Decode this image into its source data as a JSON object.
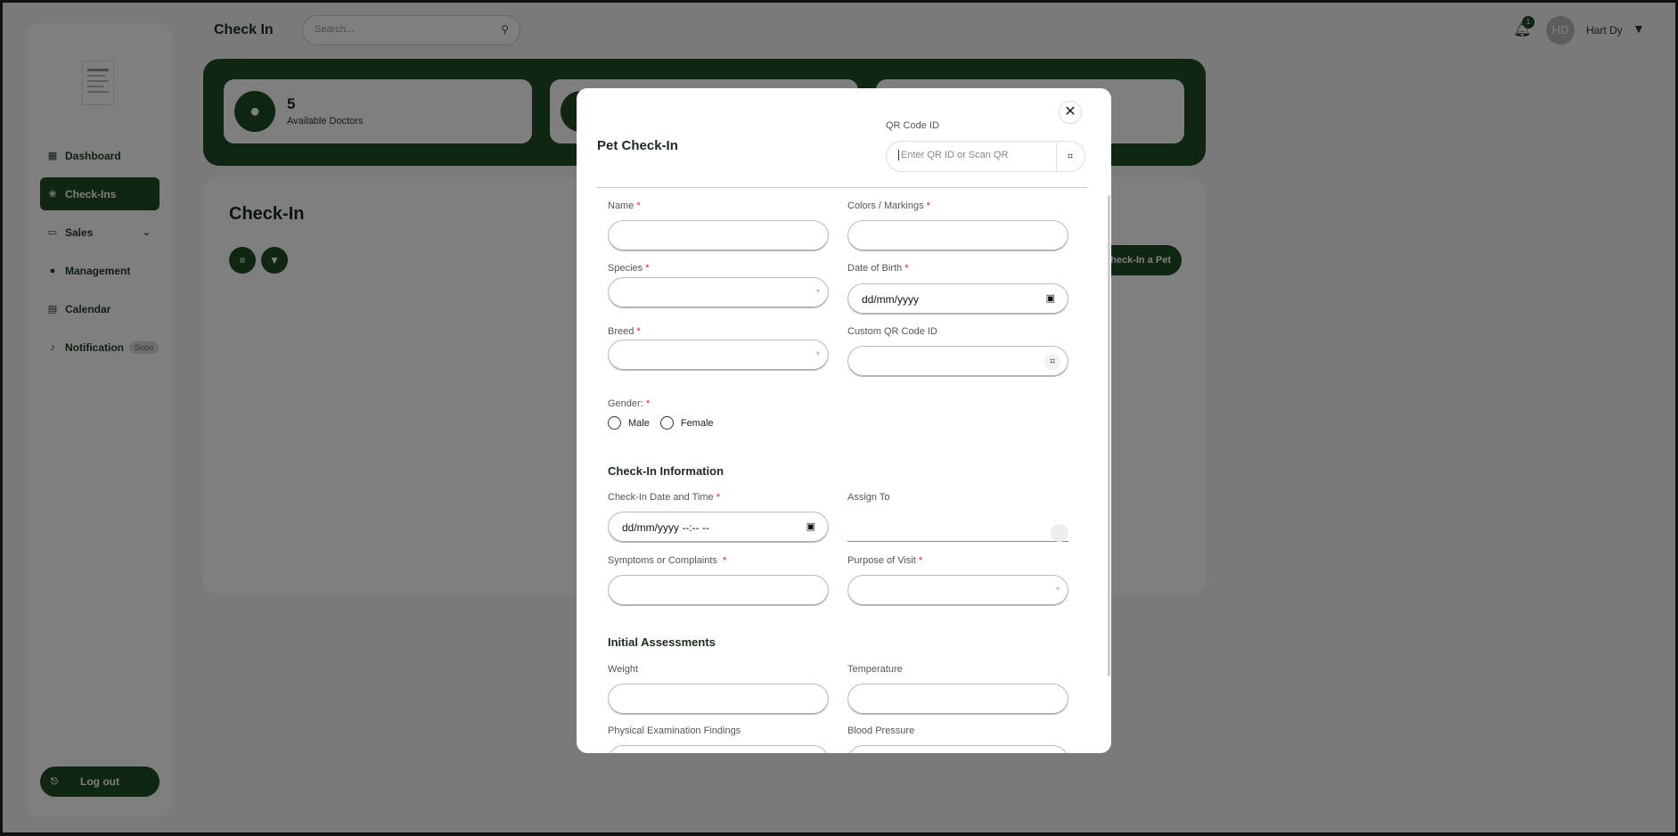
{
  "header": {
    "page_title": "Check In",
    "search_placeholder": "Search...",
    "notification_count": "1",
    "avatar_initials": "HD",
    "username": "Hart Dy"
  },
  "sidebar": {
    "items": [
      {
        "label": "Dashboard",
        "icon": "grid-icon"
      },
      {
        "label": "Check-Ins",
        "icon": "paw-icon",
        "active": true
      },
      {
        "label": "Sales",
        "icon": "card-icon"
      },
      {
        "label": "Management",
        "icon": "person-icon"
      },
      {
        "label": "Calendar",
        "icon": "calendar-icon"
      },
      {
        "label": "Notification",
        "icon": "bell-icon",
        "badge": "Soon"
      }
    ],
    "logout_label": "Log out"
  },
  "stats": {
    "doctors_count": "5",
    "doctors_label": "Available Doctors"
  },
  "main": {
    "title": "Check-In",
    "checkin_button": "Check-In a Pet"
  },
  "modal": {
    "title": "Pet Check-In",
    "qr_label": "QR Code ID",
    "qr_placeholder": "Enter QR ID or Scan QR",
    "fields": {
      "name": "Name",
      "colors": "Colors / Markings",
      "species": "Species",
      "dob": "Date of Birth",
      "dob_value": "dd/mm/yyyy",
      "breed": "Breed",
      "custom_qr": "Custom QR Code ID",
      "gender": "Gender:",
      "male": "Male",
      "female": "Female",
      "checkin_datetime": "Check-In Date and Time",
      "checkin_datetime_value": "dd/mm/yyyy --:-- --",
      "assign_to": "Assign To",
      "symptoms": "Symptoms or Complaints",
      "purpose": "Purpose of Visit",
      "weight": "Weight",
      "temperature": "Temperature",
      "physical_exam": "Physical Examination Findings",
      "blood_pressure": "Blood Pressure"
    },
    "sections": {
      "checkin_info": "Check-In Information",
      "initial_assessments": "Initial Assessments"
    },
    "required_mark": "*"
  },
  "colors": {
    "brand": "#1f4d27",
    "required": "#dd2222"
  }
}
